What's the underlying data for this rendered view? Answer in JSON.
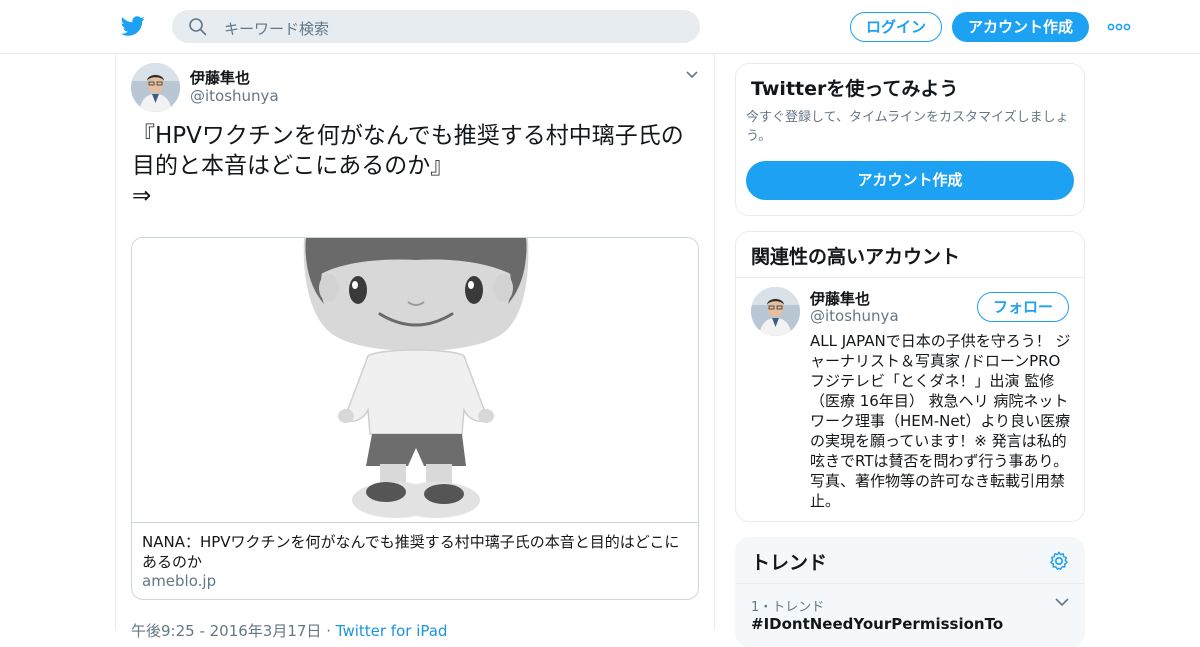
{
  "colors": {
    "accent": "#1da1f2",
    "muted": "#657786",
    "link": "#1b95e0",
    "border": "#e6ecf0"
  },
  "header": {
    "logo_icon": "twitter-bird-icon",
    "search_placeholder": "キーワード検索",
    "login_label": "ログイン",
    "signup_label": "アカウント作成",
    "more_icon": "more-dots-icon"
  },
  "tweet": {
    "author_name": "伊藤隼也",
    "author_handle": "@itoshunya",
    "text_line1": "『HPVワクチンを何がなんでも推奨する村中璃子氏の",
    "text_line2": "目的と本音はどこにあるのか』",
    "text_line3": "⇒",
    "card": {
      "title": "NANA：HPVワクチンを何がなんでも推奨する村中璃子氏の本音と目的はどこにあるのか",
      "domain": "ameblo.jp"
    },
    "meta_time": "午後9:25 - 2016年3月17日",
    "meta_sep": " · ",
    "meta_source": "Twitter for iPad"
  },
  "signup_panel": {
    "title": "Twitterを使ってみよう",
    "description": "今すぐ登録して、タイムラインをカスタマイズしましょう。",
    "button_label": "アカウント作成"
  },
  "related_panel": {
    "title": "関連性の高いアカウント",
    "account": {
      "name": "伊藤隼也",
      "handle": "@itoshunya",
      "follow_label": "フォロー",
      "bio": "ALL JAPANで日本の子供を守ろう！ ジャーナリスト＆写真家 /ドローンPRO フジテレビ「とくダネ！」出演 監修（医療 16年目） 救急ヘリ 病院ネットワーク理事（HEM-Net）より良い医療の実現を願っています！※ 発言は私的呟きでRTは賛否を問わず行う事あり。写真、著作物等の許可なき転載引用禁止。"
    }
  },
  "trends_panel": {
    "title": "トレンド",
    "items": [
      {
        "meta": "1・トレンド",
        "name": "#IDontNeedYourPermissionTo"
      }
    ]
  }
}
